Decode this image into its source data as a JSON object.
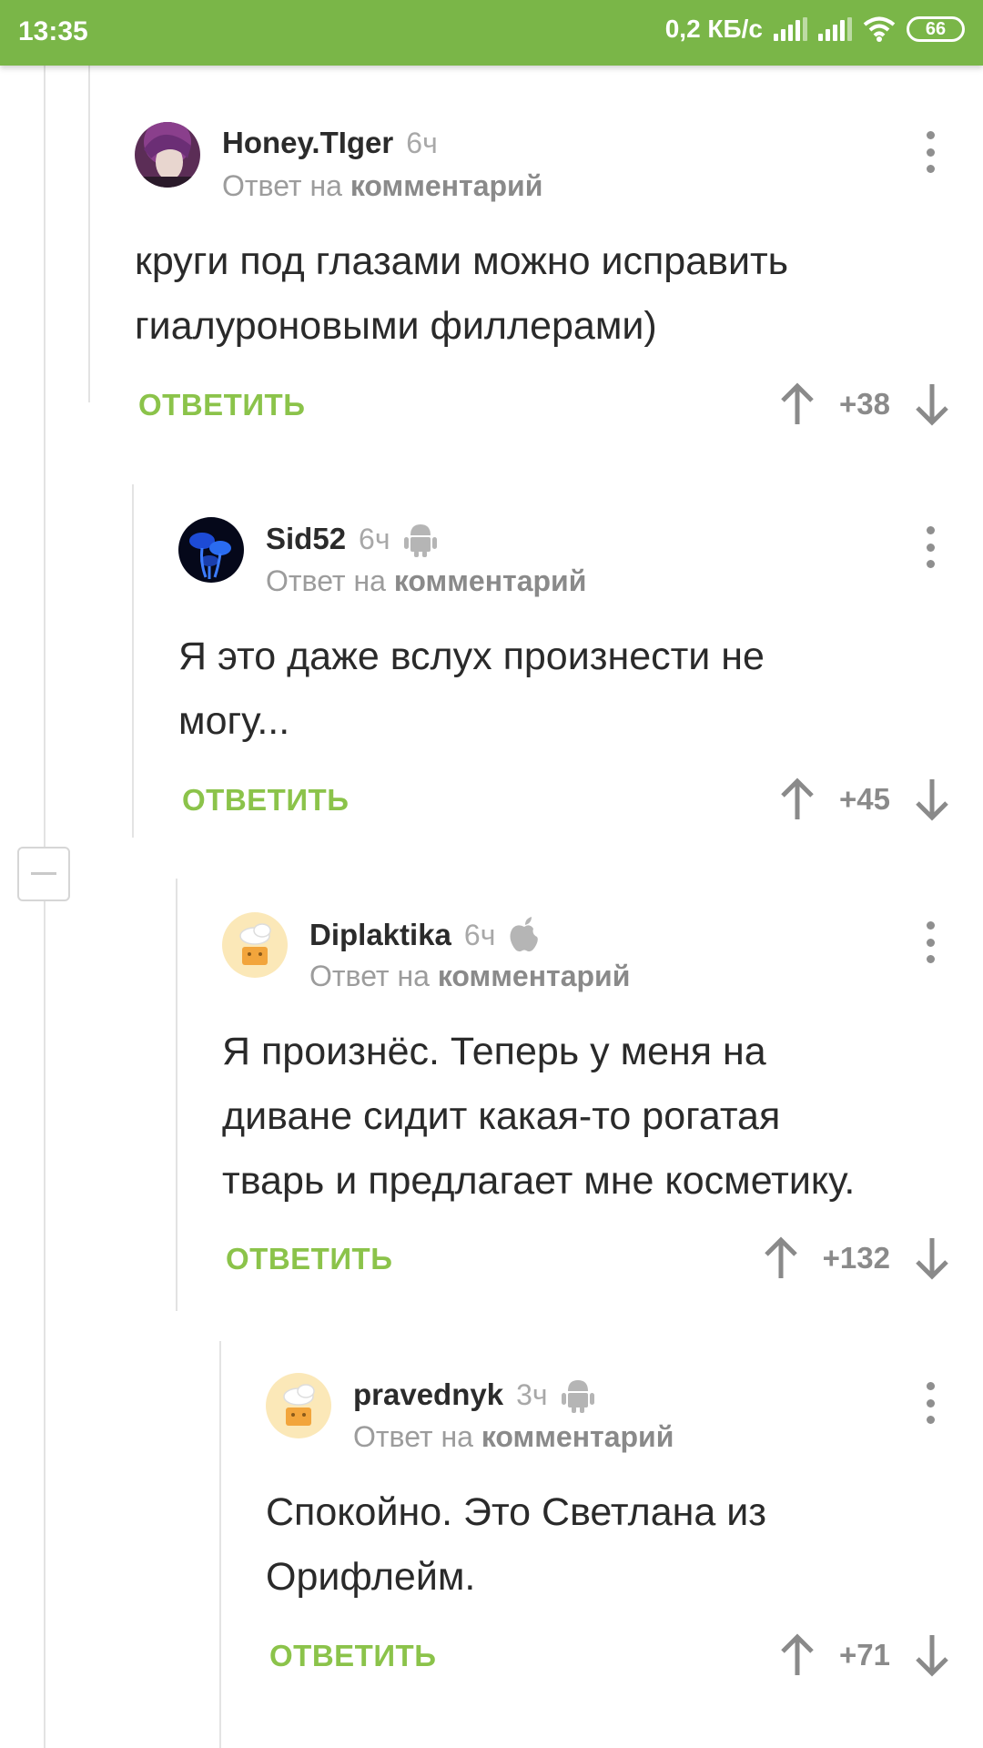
{
  "status_bar": {
    "time": "13:35",
    "speed": "0,2 КБ/с",
    "battery": "66"
  },
  "colors": {
    "status_bar_bg": "#7ab648",
    "reply_button": "#8bc34a"
  },
  "comments": [
    {
      "author": "Honey.TIger",
      "time": "6ч",
      "platform_icon": "",
      "reply_prefix": "Ответ на",
      "reply_link": "комментарий",
      "text_lines": [
        "круги под глазами можно исправить",
        "гиалуроновыми филлерами)"
      ],
      "reply_label": "ОТВЕТИТЬ",
      "score": "+38"
    },
    {
      "author": "Sid52",
      "time": "6ч",
      "platform_icon": "android-icon",
      "reply_prefix": "Ответ на",
      "reply_link": "комментарий",
      "text_lines": [
        "Я это даже вслух произнести не",
        "могу..."
      ],
      "reply_label": "ОТВЕТИТЬ",
      "score": "+45"
    },
    {
      "author": "Diplaktika",
      "time": "6ч",
      "platform_icon": "apple-icon",
      "reply_prefix": "Ответ на",
      "reply_link": "комментарий",
      "text_lines": [
        "Я произнёс. Теперь у меня на",
        "диване сидит какая-то рогатая",
        "тварь и предлагает мне косметику."
      ],
      "reply_label": "ОТВЕТИТЬ",
      "score": "+132"
    },
    {
      "author": "pravednyk",
      "time": "3ч",
      "platform_icon": "android-icon",
      "reply_prefix": "Ответ на",
      "reply_link": "комментарий",
      "text_lines": [
        "Спокойно. Это Светлана из",
        "Орифлейм."
      ],
      "reply_label": "ОТВЕТИТЬ",
      "score": "+71"
    }
  ]
}
